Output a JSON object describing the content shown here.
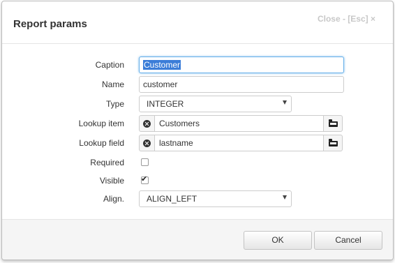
{
  "dialog": {
    "title": "Report params",
    "close_label": "Close - [Esc] ×"
  },
  "form": {
    "caption": {
      "label": "Caption",
      "value": "Customer"
    },
    "name": {
      "label": "Name",
      "value": "customer"
    },
    "type": {
      "label": "Type",
      "value": "INTEGER"
    },
    "lookup_item": {
      "label": "Lookup item",
      "value": "Customers"
    },
    "lookup_field": {
      "label": "Lookup field",
      "value": "lastname"
    },
    "required": {
      "label": "Required",
      "checked": false
    },
    "visible": {
      "label": "Visible",
      "checked": true,
      "mark": "✔"
    },
    "align": {
      "label": "Align.",
      "value": "ALIGN_LEFT"
    }
  },
  "footer": {
    "ok_label": "OK",
    "cancel_label": "Cancel"
  },
  "icons": {
    "clear": "x-circle-icon",
    "browse": "folder-open-icon",
    "dropdown": "caret-down-icon"
  },
  "colors": {
    "focus_border": "#66afe9",
    "selection": "#3b7dd8",
    "footer_bg": "#f5f5f5"
  }
}
